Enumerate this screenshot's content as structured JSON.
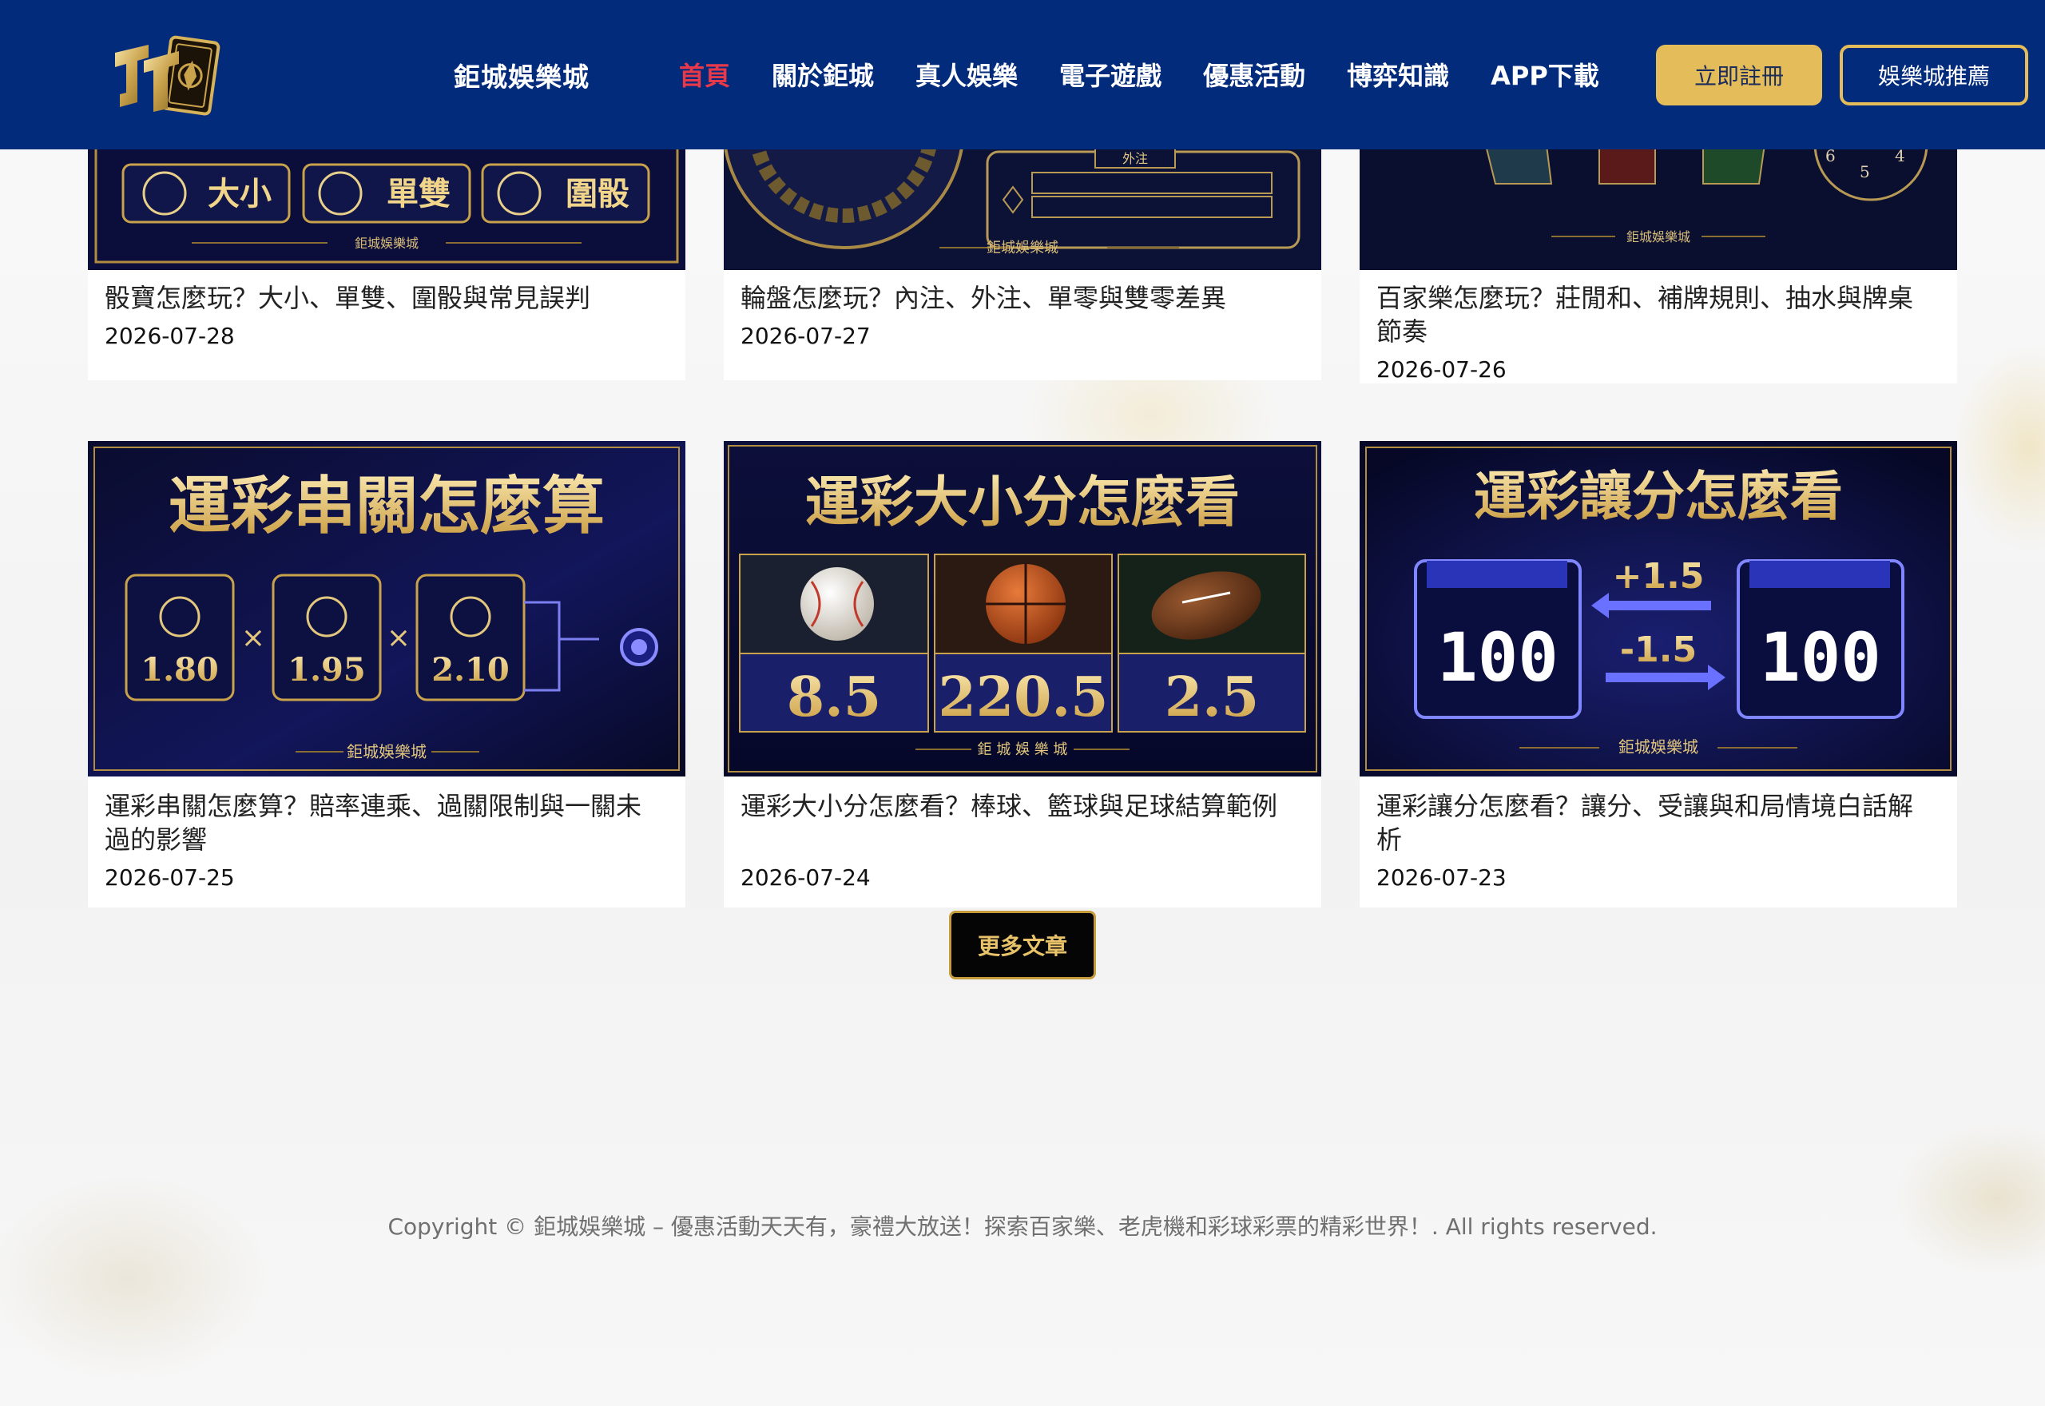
{
  "header": {
    "brand": "鉅城娛樂城",
    "nav": [
      "首頁",
      "關於鉅城",
      "真人娛樂",
      "電子遊戲",
      "優惠活動",
      "博弈知識",
      "APP下載"
    ],
    "register_label": "立即註冊",
    "recommend_label": "娛樂城推薦"
  },
  "posts": [
    {
      "title": "骰寶怎麼玩？大小、單雙、圍骰與常見誤判",
      "date": "2026-07-28",
      "image": {
        "labels": [
          "大小",
          "單雙",
          "圍骰"
        ],
        "watermark": "鉅城娛樂城"
      }
    },
    {
      "title": "輪盤怎麼玩？內注、外注、單零與雙零差異",
      "date": "2026-07-27",
      "image": {
        "labels": [
          "外注"
        ],
        "watermark": "鉅城娛樂城"
      }
    },
    {
      "title": "百家樂怎麼玩？莊閒和、補牌規則、抽水與牌桌節奏",
      "date": "2026-07-26",
      "image": {
        "labels": [
          "6",
          "5",
          "4"
        ],
        "watermark": "鉅城娛樂城"
      }
    },
    {
      "title": "運彩串關怎麼算？賠率連乘、過關限制與一關未過的影響",
      "date": "2026-07-25",
      "image": {
        "heading": "運彩串關怎麼算",
        "odds": [
          "1.80",
          "1.95",
          "2.10"
        ],
        "watermark": "鉅城娛樂城"
      }
    },
    {
      "title": "運彩大小分怎麼看？棒球、籃球與足球結算範例",
      "date": "2026-07-24",
      "image": {
        "heading": "運彩大小分怎麼看",
        "values": [
          "8.5",
          "220.5",
          "2.5"
        ],
        "watermark": "鉅 城 娛 樂 城"
      }
    },
    {
      "title": "運彩讓分怎麼看？讓分、受讓與和局情境白話解析",
      "date": "2026-07-23",
      "image": {
        "heading": "運彩讓分怎麼看",
        "left_score": "100",
        "right_score": "100",
        "plus": "+1.5",
        "minus": "-1.5",
        "watermark": "鉅城娛樂城"
      }
    }
  ],
  "more_label": "更多文章",
  "footer": "Copyright © 鉅城娛樂城 – 優惠活動天天有，豪禮大放送！探索百家樂、老虎機和彩球彩票的精彩世界！. All rights reserved.",
  "colors": {
    "header_bg": "#032b7c",
    "accent_gold": "#e4bd5a",
    "nav_active": "#e8394a"
  }
}
